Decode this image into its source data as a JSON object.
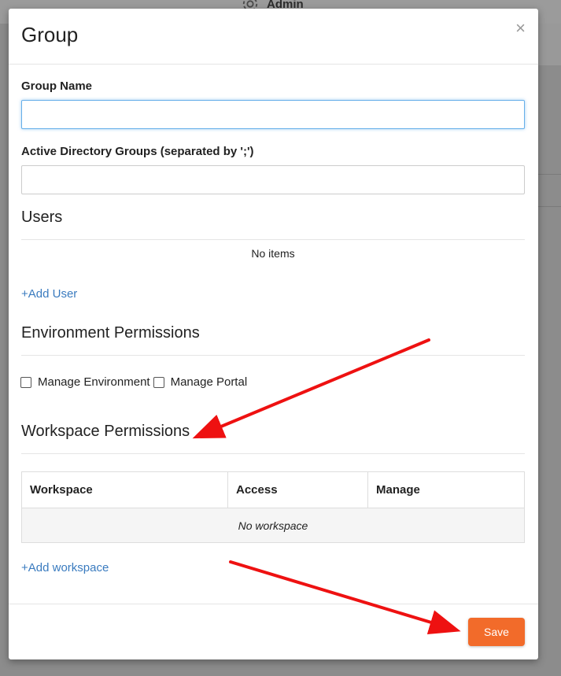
{
  "background": {
    "admin_label": "Admin"
  },
  "modal": {
    "title": "Group",
    "close_symbol": "×",
    "group_name": {
      "label": "Group Name",
      "value": "",
      "placeholder": ""
    },
    "ad_groups": {
      "label": "Active Directory Groups (separated by ';')",
      "value": "",
      "placeholder": ""
    },
    "users": {
      "title": "Users",
      "empty_text": "No items",
      "add_link": "+Add User"
    },
    "environment_permissions": {
      "title": "Environment Permissions",
      "options": [
        {
          "label": "Manage Environment",
          "checked": false
        },
        {
          "label": "Manage Portal",
          "checked": false
        }
      ]
    },
    "workspace_permissions": {
      "title": "Workspace Permissions",
      "columns": [
        "Workspace",
        "Access",
        "Manage"
      ],
      "empty_text": "No workspace",
      "add_link": "+Add workspace"
    },
    "save_label": "Save"
  },
  "colors": {
    "accent_link": "#3a7bbf",
    "save_button": "#f26b2a",
    "annotation_arrow": "#ee1111",
    "focus_border": "#66afe9"
  },
  "icons": [
    "gear-icon",
    "close-icon",
    "checkbox-icon"
  ]
}
